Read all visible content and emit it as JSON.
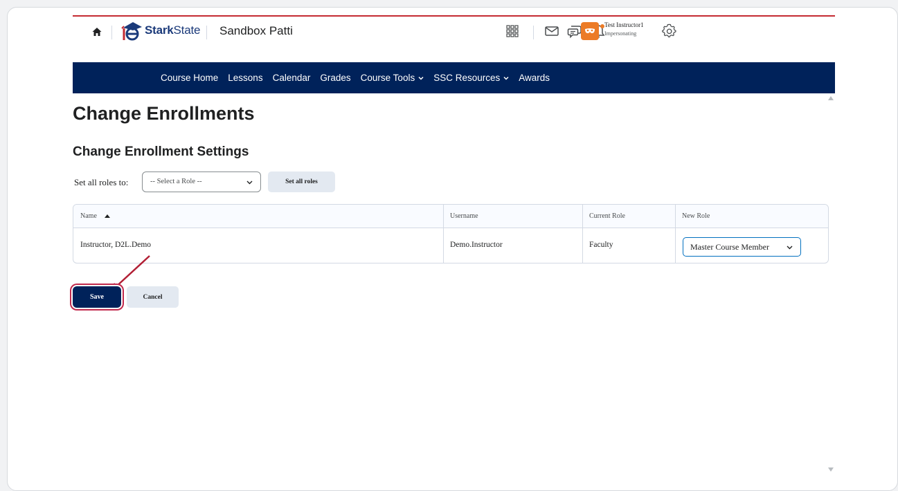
{
  "header": {
    "logo": {
      "part1": "Stark",
      "part2": "State"
    },
    "course_title": "Sandbox Patti",
    "user": {
      "name": "Test Instructor1",
      "status": "Impersonating"
    }
  },
  "nav": {
    "items": [
      {
        "label": "Course Home",
        "dropdown": false
      },
      {
        "label": "Lessons",
        "dropdown": false
      },
      {
        "label": "Calendar",
        "dropdown": false
      },
      {
        "label": "Grades",
        "dropdown": false
      },
      {
        "label": "Course Tools",
        "dropdown": true
      },
      {
        "label": "SSC Resources",
        "dropdown": true
      },
      {
        "label": "Awards",
        "dropdown": false
      }
    ]
  },
  "page": {
    "title": "Change Enrollments",
    "section_title": "Change Enrollment Settings",
    "set_all_label": "Set all roles to:",
    "role_select_value": "-- Select a Role --",
    "set_all_button": "Set all roles"
  },
  "table": {
    "headers": {
      "name": "Name",
      "username": "Username",
      "current_role": "Current Role",
      "new_role": "New Role"
    },
    "rows": [
      {
        "name": "Instructor, D2L.Demo",
        "username": "Demo.Instructor",
        "current_role": "Faculty",
        "new_role": "Master Course Member"
      }
    ]
  },
  "actions": {
    "save": "Save",
    "cancel": "Cancel"
  },
  "colors": {
    "navbar": "#00225a",
    "accent_red": "#c42a31",
    "avatar": "#ec7b26",
    "highlight": "#c0284b"
  }
}
